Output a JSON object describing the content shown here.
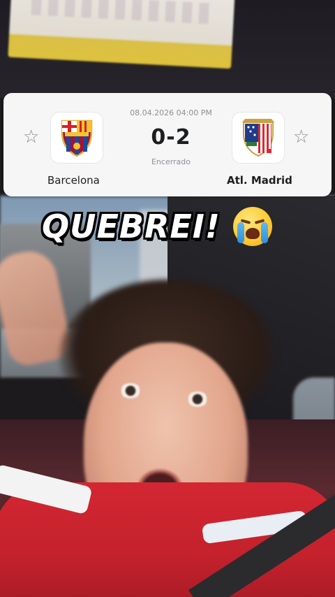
{
  "match": {
    "datetime": "08.04.2026 04:00 PM",
    "score": "0-2",
    "status": "Encerrado",
    "home": {
      "name": "Barcelona",
      "logo": "fc-barcelona-crest"
    },
    "away": {
      "name": "Atl. Madrid",
      "logo": "atletico-madrid-crest"
    },
    "favorite_icon": "star-outline-icon"
  },
  "caption": {
    "text": "QUEBREI!",
    "emoji": "loudly-crying-face"
  },
  "colors": {
    "card_bg": "#f6f6f7",
    "text_primary": "#1d1e20",
    "text_secondary": "#8d8f93",
    "caption_fill": "#ffffff",
    "caption_outline": "#000000"
  }
}
